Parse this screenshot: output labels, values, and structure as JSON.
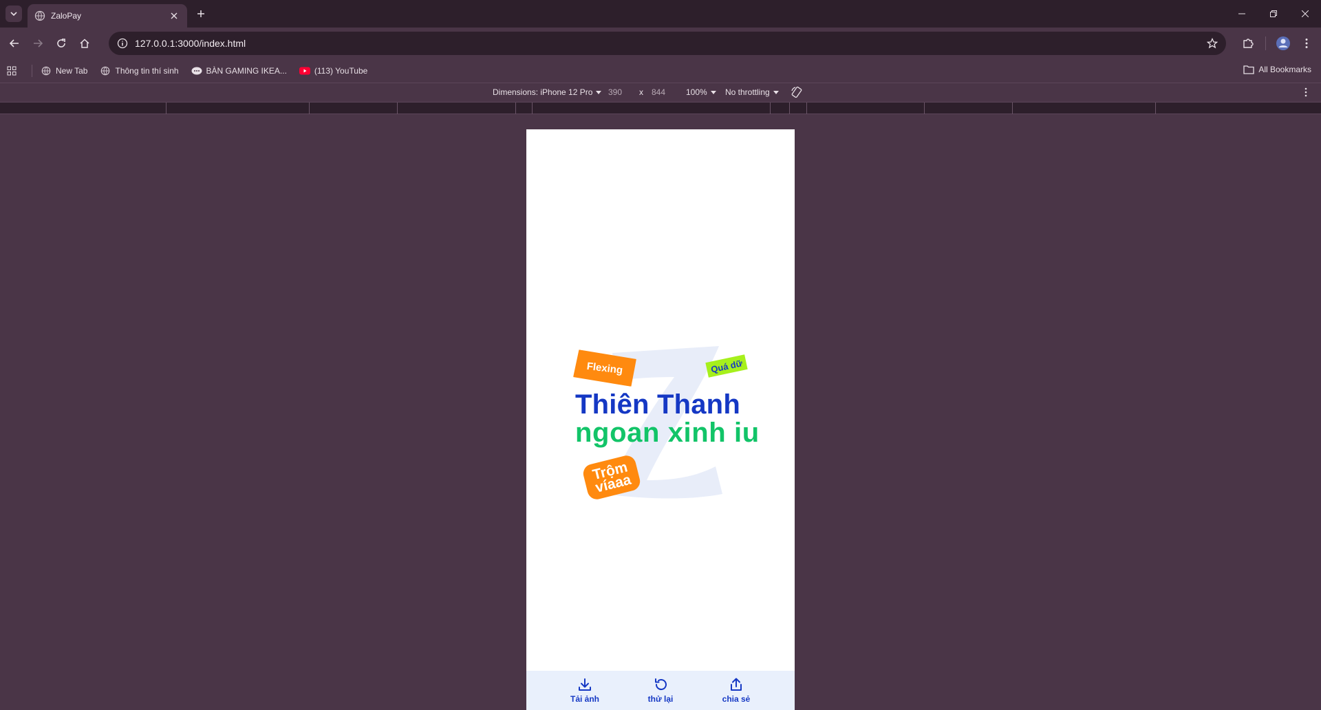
{
  "browser": {
    "tab": {
      "title": "ZaloPay"
    },
    "address": {
      "url": "127.0.0.1:3000/index.html"
    },
    "bookmarks": [
      {
        "label": "New Tab",
        "icon": "globe-icon"
      },
      {
        "label": "Thông tin thí sinh",
        "icon": "globe-icon"
      },
      {
        "label": "BÀN GAMING IKEA...",
        "icon": "chat-icon"
      },
      {
        "label": "(113) YouTube",
        "icon": "youtube-icon"
      }
    ],
    "all_bookmarks": "All Bookmarks"
  },
  "devtools": {
    "dimensions_label": "Dimensions: iPhone 12 Pro",
    "width": "390",
    "times": "x",
    "height": "844",
    "zoom": "100%",
    "throttling": "No throttling"
  },
  "page": {
    "name_line1": "Thiên Thanh",
    "name_line2": "ngoan xinh iu",
    "stickers": {
      "flexing": "Flexing",
      "quadu": "Quá dữ",
      "trom_line1": "Trộm",
      "trom_line2": "víaaa"
    },
    "actions": [
      {
        "label": "Tải ảnh",
        "icon": "download-icon"
      },
      {
        "label": "thử lại",
        "icon": "retry-icon"
      },
      {
        "label": "chia sẻ",
        "icon": "share-icon"
      }
    ],
    "colors": {
      "primary_blue": "#1538c4",
      "accent_green": "#12c468",
      "sticker_orange": "#ff8a0f",
      "sticker_lime": "#a6f01c"
    }
  }
}
